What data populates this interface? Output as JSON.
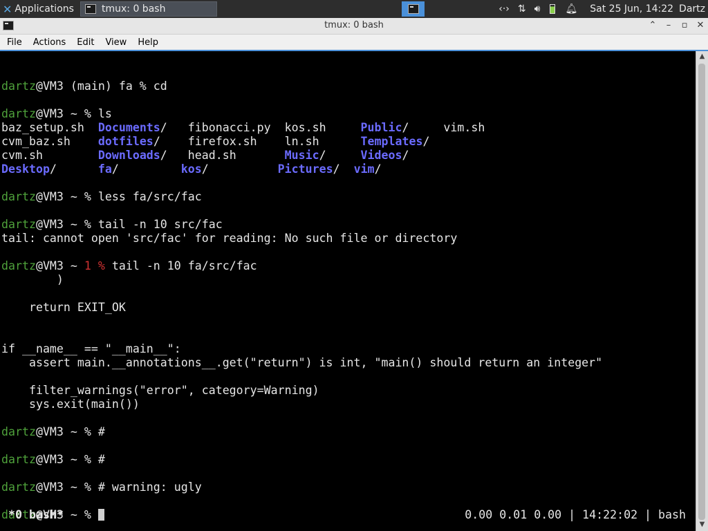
{
  "panel": {
    "app_menu_label": "Applications ☰",
    "task_label": "tmux: 0 bash",
    "clock": "Sat 25 Jun, 14:22",
    "user": "Dartz"
  },
  "window": {
    "title": "tmux: 0 bash",
    "minimize_symbol": "–",
    "maximize_symbol": "▫",
    "close_symbol": "✕",
    "shade_symbol": "⌃"
  },
  "menu": [
    "File",
    "Actions",
    "Edit",
    "View",
    "Help"
  ],
  "terminal": {
    "lines": [
      [],
      [
        [
          "dartz",
          "g"
        ],
        [
          "@VM3 (main) fa % cd",
          ""
        ]
      ],
      [],
      [
        [
          "dartz",
          "g"
        ],
        [
          "@VM3 ~ % ls",
          ""
        ]
      ],
      [
        [
          "baz_setup.sh  ",
          ""
        ],
        [
          "Documents",
          "d"
        ],
        [
          "/   fibonacci.py  kos.sh     ",
          ""
        ],
        [
          "Public",
          "d"
        ],
        [
          "/     vim.sh",
          ""
        ]
      ],
      [
        [
          "cvm_baz.sh    ",
          ""
        ],
        [
          "dotfiles",
          "d"
        ],
        [
          "/    firefox.sh    ln.sh      ",
          ""
        ],
        [
          "Templates",
          "d"
        ],
        [
          "/",
          ""
        ]
      ],
      [
        [
          "cvm.sh        ",
          ""
        ],
        [
          "Downloads",
          "d"
        ],
        [
          "/   head.sh       ",
          ""
        ],
        [
          "Music",
          "d"
        ],
        [
          "/     ",
          ""
        ],
        [
          "Videos",
          "d"
        ],
        [
          "/",
          ""
        ]
      ],
      [
        [
          "Desktop",
          "d"
        ],
        [
          "/      ",
          ""
        ],
        [
          "fa",
          "d"
        ],
        [
          "/         ",
          ""
        ],
        [
          "kos",
          "d"
        ],
        [
          "/          ",
          ""
        ],
        [
          "Pictures",
          "d"
        ],
        [
          "/  ",
          ""
        ],
        [
          "vim",
          "d"
        ],
        [
          "/",
          ""
        ]
      ],
      [],
      [
        [
          "dartz",
          "g"
        ],
        [
          "@VM3 ~ % less fa/src/fac",
          ""
        ]
      ],
      [],
      [
        [
          "dartz",
          "g"
        ],
        [
          "@VM3 ~ % tail -n 10 src/fac",
          ""
        ]
      ],
      [
        [
          "tail: cannot open 'src/fac' for reading: No such file or directory",
          ""
        ]
      ],
      [],
      [
        [
          "dartz",
          "g"
        ],
        [
          "@VM3 ~ ",
          ""
        ],
        [
          "1 %",
          "r"
        ],
        [
          " tail -n 10 fa/src/fac",
          ""
        ]
      ],
      [
        [
          "        )",
          ""
        ]
      ],
      [],
      [
        [
          "    return EXIT_OK",
          ""
        ]
      ],
      [],
      [],
      [
        [
          "if __name__ == \"__main__\":",
          ""
        ]
      ],
      [
        [
          "    assert main.__annotations__.get(\"return\") is int, \"main() should return an integer\"",
          ""
        ]
      ],
      [],
      [
        [
          "    filter_warnings(\"error\", category=Warning)",
          ""
        ]
      ],
      [
        [
          "    sys.exit(main())",
          ""
        ]
      ],
      [],
      [
        [
          "dartz",
          "g"
        ],
        [
          "@VM3 ~ % #",
          ""
        ]
      ],
      [],
      [
        [
          "dartz",
          "g"
        ],
        [
          "@VM3 ~ % #",
          ""
        ]
      ],
      [],
      [
        [
          "dartz",
          "g"
        ],
        [
          "@VM3 ~ % # warning: ugly",
          ""
        ]
      ],
      [],
      [
        [
          "dartz",
          "g"
        ],
        [
          "@VM3 ~ % ",
          ""
        ],
        [
          "",
          "cursor"
        ]
      ]
    ]
  },
  "tmux_status": {
    "window": "*0 bash*",
    "right": "0.00 0.01 0.00 | 14:22:02 | bash"
  }
}
